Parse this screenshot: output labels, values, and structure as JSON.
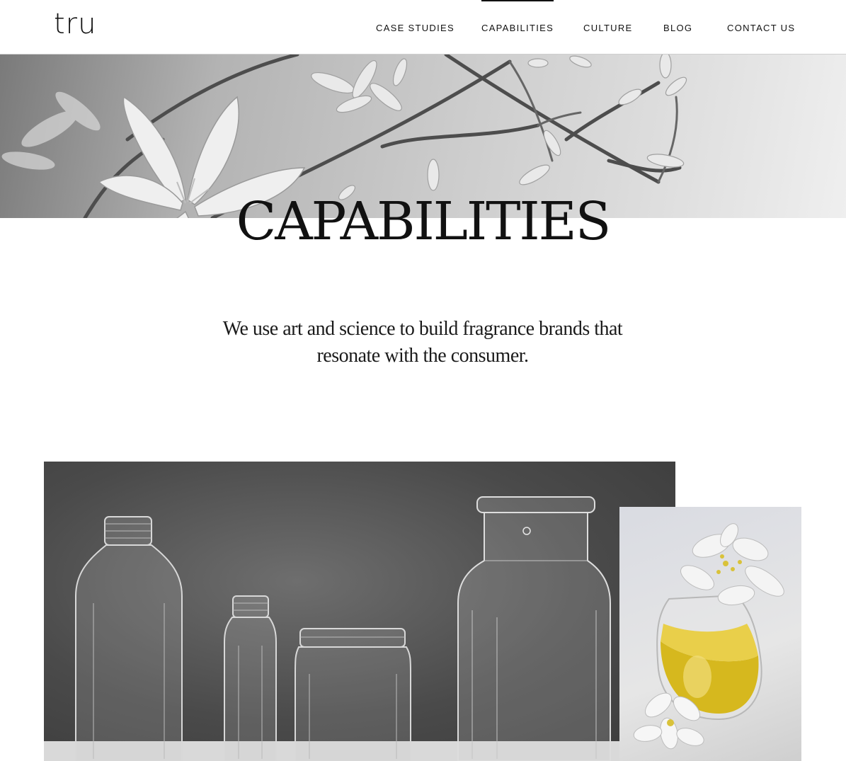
{
  "header": {
    "logo": "tru",
    "nav": [
      {
        "label": "CASE STUDIES",
        "active": false
      },
      {
        "label": "CAPABILITIES",
        "active": true
      },
      {
        "label": "CULTURE",
        "active": false
      },
      {
        "label": "BLOG",
        "active": false
      },
      {
        "label": "CONTACT US",
        "active": false
      }
    ]
  },
  "hero": {
    "title": "CAPABILITIES"
  },
  "intro": {
    "text": "We use art and science to build fragrance brands that resonate with the consumer."
  },
  "colors": {
    "text": "#111111",
    "header_border": "#cfcfcf",
    "oil_yellow": "#d6b81e"
  },
  "icons": [
    "hero-flowers-image",
    "bottles-photo",
    "oil-bottle-flower-photo"
  ]
}
